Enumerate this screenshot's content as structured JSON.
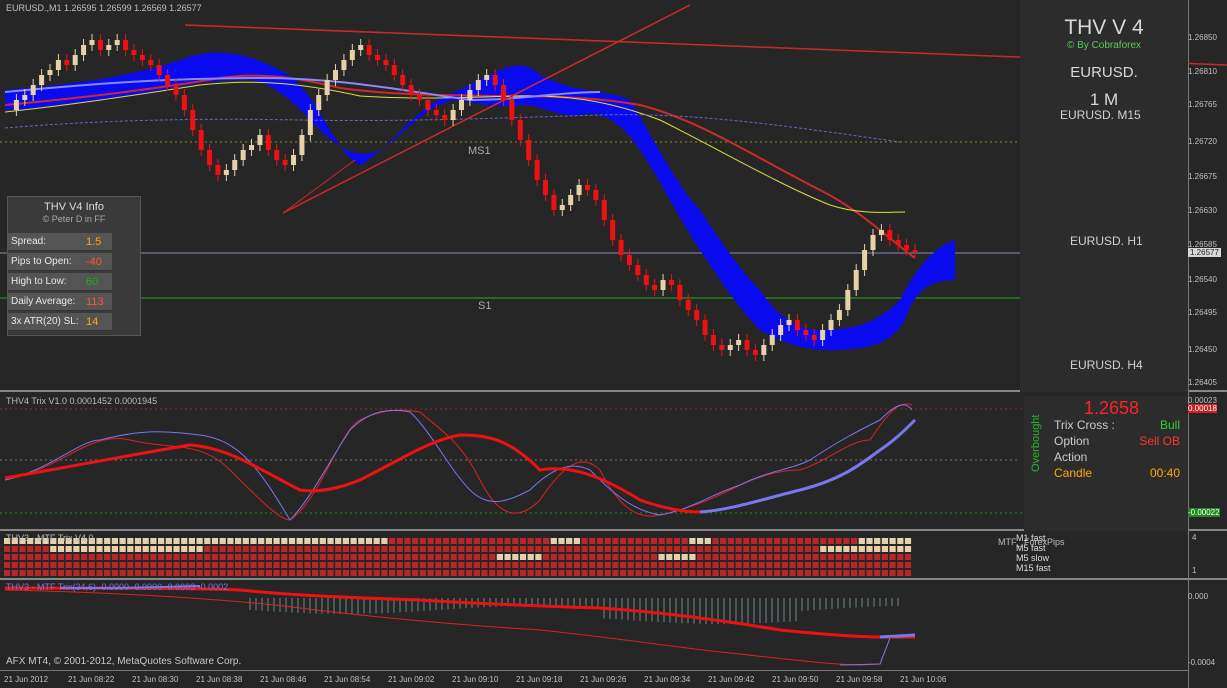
{
  "chart_header": "EURUSD.,M1  1.26595 1.26599 1.26569 1.26577",
  "labels": {
    "ms1": "MS1",
    "s1": "S1"
  },
  "info_panel": {
    "title": "THV  V4  Info",
    "credit": "© Peter D in FF",
    "rows": [
      {
        "label": "Spread:",
        "value": "1.5",
        "color": "#ffaa00"
      },
      {
        "label": "Pips to Open:",
        "value": "-40",
        "color": "#ff5533"
      },
      {
        "label": "High to Low:",
        "value": "60",
        "color": "#22aa22"
      },
      {
        "label": "Daily Average:",
        "value": "113",
        "color": "#ff5533"
      },
      {
        "label": "3x ATR(20) SL:",
        "value": "14",
        "color": "#ffaa00"
      }
    ]
  },
  "thv_panel": {
    "title": "THV V 4",
    "by": "© By Cobraforex",
    "symbol": "EURUSD.",
    "timeframe": "1 M",
    "mini_charts": [
      "EURUSD.  M15",
      "EURUSD.  H1",
      "EURUSD.  H4"
    ]
  },
  "trix_indicator": {
    "header": "THV4 Trix V1.0 0.0001452 0.0001945",
    "price": "1.2658",
    "overbought_label": "Overbought",
    "rows": [
      {
        "label": "Trix Cross :",
        "value": "Bull",
        "color": "#33cc33"
      },
      {
        "label": "Option",
        "value": "Sell OB",
        "color": "#ff3333"
      },
      {
        "label": "Action",
        "value": "",
        "color": "#ff3333"
      },
      {
        "label": "Candle",
        "value": "00:40",
        "color": "#ffaa00",
        "label_color": "#ffaa00"
      }
    ]
  },
  "mtf_grid": {
    "header": "THV3 - MTF Trix V4.0 ",
    "right_label": "MTF_ ForexPips",
    "rows": [
      "M1 fast",
      "M5 fast",
      "M5 slow",
      "M15 fast"
    ],
    "colors": {
      "bull": "#e6d2aa",
      "bear": "#b82828"
    }
  },
  "mtf_trix": {
    "header": "THV3 - MTF Trix(34,6) -0.0000 -0.0000 -0.0003 -0.0002"
  },
  "copyright": "AFX MT4, © 2001-2012, MetaQuotes Software Corp.",
  "price_axis": {
    "main": [
      "1.26850",
      "1.26810",
      "1.26765",
      "1.26720",
      "1.26675",
      "1.26630",
      "1.26585",
      "1.26577",
      "1.26540",
      "1.26495",
      "1.26450",
      "1.26405"
    ],
    "trix": [
      "0.00023",
      "0.00018",
      "-0.00022"
    ],
    "grid": [
      "4",
      "1"
    ],
    "mtf": [
      "0.000",
      "-0.0004"
    ]
  },
  "time_axis": [
    "21 Jun 2012",
    "21 Jun 08:22",
    "21 Jun 08:30",
    "21 Jun 08:38",
    "21 Jun 08:46",
    "21 Jun 08:54",
    "21 Jun 09:02",
    "21 Jun 09:10",
    "21 Jun 09:18",
    "21 Jun 09:26",
    "21 Jun 09:34",
    "21 Jun 09:42",
    "21 Jun 09:50",
    "21 Jun 09:58",
    "21 Jun 10:06"
  ],
  "colors": {
    "bull_candle": "#e6d2aa",
    "bear_candle": "#ee1111",
    "cloud": "#0a0aee",
    "background": "#262626"
  }
}
